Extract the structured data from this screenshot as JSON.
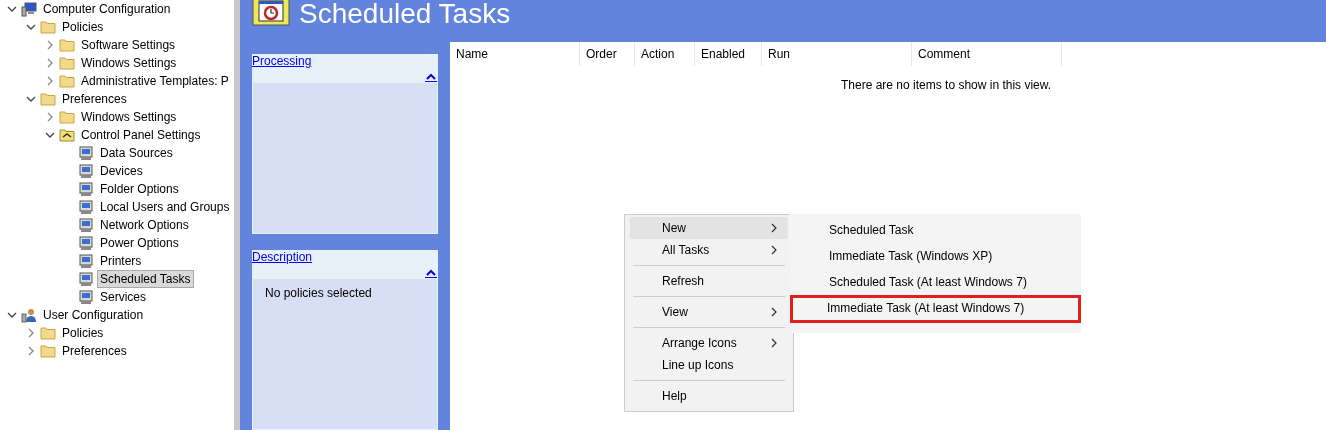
{
  "tree": [
    {
      "label": "Computer Configuration",
      "kind": "computer",
      "expanded": true,
      "selected": false,
      "children": [
        {
          "label": "Policies",
          "kind": "folder",
          "expanded": true,
          "selected": false,
          "children": [
            {
              "label": "Software Settings",
              "kind": "folder",
              "expanded": false,
              "selected": false
            },
            {
              "label": "Windows Settings",
              "kind": "folder",
              "expanded": false,
              "selected": false
            },
            {
              "label": "Administrative Templates: P",
              "kind": "folder",
              "expanded": false,
              "selected": false
            }
          ]
        },
        {
          "label": "Preferences",
          "kind": "folder",
          "expanded": true,
          "selected": false,
          "children": [
            {
              "label": "Windows Settings",
              "kind": "folder",
              "expanded": false,
              "selected": false
            },
            {
              "label": "Control Panel Settings",
              "kind": "control-panel",
              "expanded": true,
              "selected": false,
              "children": [
                {
                  "label": "Data Sources",
                  "kind": "item",
                  "selected": false
                },
                {
                  "label": "Devices",
                  "kind": "item",
                  "selected": false
                },
                {
                  "label": "Folder Options",
                  "kind": "item",
                  "selected": false
                },
                {
                  "label": "Local Users and Groups",
                  "kind": "item",
                  "selected": false
                },
                {
                  "label": "Network Options",
                  "kind": "item",
                  "selected": false
                },
                {
                  "label": "Power Options",
                  "kind": "item",
                  "selected": false
                },
                {
                  "label": "Printers",
                  "kind": "item",
                  "selected": false
                },
                {
                  "label": "Scheduled Tasks",
                  "kind": "item",
                  "selected": true
                },
                {
                  "label": "Services",
                  "kind": "item",
                  "selected": false
                }
              ]
            }
          ]
        }
      ]
    },
    {
      "label": "User Configuration",
      "kind": "user",
      "expanded": true,
      "selected": false,
      "children": [
        {
          "label": "Policies",
          "kind": "folder",
          "expanded": false,
          "selected": false
        },
        {
          "label": "Preferences",
          "kind": "folder",
          "expanded": false,
          "selected": false
        }
      ]
    }
  ],
  "header": {
    "title": "Scheduled Tasks"
  },
  "side_panels": [
    {
      "title": "Processing",
      "expanded": true
    },
    {
      "title": "Description",
      "expanded": true,
      "text": "No policies selected"
    }
  ],
  "table": {
    "columns": [
      "Name",
      "Order",
      "Action",
      "Enabled",
      "Run",
      "Comment"
    ],
    "empty_message": "There are no items to show in this view."
  },
  "context_menu": [
    {
      "kind": "item",
      "label": "New",
      "submenu": true,
      "selected": true
    },
    {
      "kind": "item",
      "label": "All Tasks",
      "submenu": true,
      "selected": false
    },
    {
      "kind": "separator"
    },
    {
      "kind": "item",
      "label": "Refresh",
      "submenu": false,
      "selected": false
    },
    {
      "kind": "separator"
    },
    {
      "kind": "item",
      "label": "View",
      "submenu": true,
      "selected": false
    },
    {
      "kind": "separator"
    },
    {
      "kind": "item",
      "label": "Arrange Icons",
      "submenu": true,
      "selected": false
    },
    {
      "kind": "item",
      "label": "Line up Icons",
      "submenu": false,
      "selected": false
    },
    {
      "kind": "separator"
    },
    {
      "kind": "item",
      "label": "Help",
      "submenu": false,
      "selected": false
    }
  ],
  "submenu": [
    {
      "label": "Scheduled Task",
      "outlined": false
    },
    {
      "label": "Immediate Task (Windows XP)",
      "outlined": false
    },
    {
      "label": "Scheduled Task (At least Windows 7)",
      "outlined": false
    },
    {
      "label": "Immediate Task (At least Windows 7)",
      "outlined": true
    }
  ]
}
